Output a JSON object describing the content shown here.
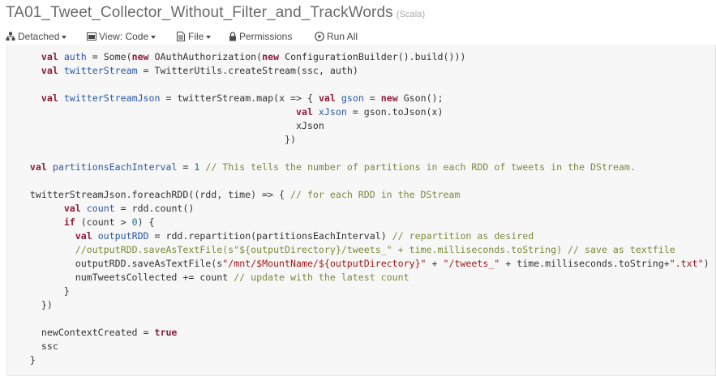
{
  "notebook": {
    "title": "TA01_Tweet_Collector_Without_Filter_and_TrackWords",
    "language": "(Scala)"
  },
  "toolbar": {
    "detached_label": "Detached",
    "view_label": "View: Code",
    "file_label": "File",
    "permissions_label": "Permissions",
    "run_all_label": "Run All"
  },
  "icons": [
    "cluster-icon",
    "view-icon",
    "file-icon",
    "lock-icon",
    "run-icon"
  ],
  "colors": {
    "keyword": "#8b1d38",
    "variable": "#2b57a6",
    "string": "#a11a1a",
    "comment": "#7a8b3a",
    "number": "#1a6fa0"
  },
  "code_lines": [
    [
      {
        "t": "      "
      },
      {
        "t": "val",
        "c": "kw"
      },
      {
        "t": " "
      },
      {
        "t": "auth",
        "c": "vr"
      },
      {
        "t": " = Some("
      },
      {
        "t": "new",
        "c": "kw"
      },
      {
        "t": " OAuthAuthorization("
      },
      {
        "t": "new",
        "c": "kw"
      },
      {
        "t": " ConfigurationBuilder().build()))"
      }
    ],
    [
      {
        "t": "      "
      },
      {
        "t": "val",
        "c": "kw"
      },
      {
        "t": " "
      },
      {
        "t": "twitterStream",
        "c": "vr"
      },
      {
        "t": " = TwitterUtils.createStream(ssc, auth)"
      }
    ],
    [
      {
        "t": ""
      }
    ],
    [
      {
        "t": "      "
      },
      {
        "t": "val",
        "c": "kw"
      },
      {
        "t": " "
      },
      {
        "t": "twitterStreamJson",
        "c": "vr"
      },
      {
        "t": " = twitterStream.map(x => { "
      },
      {
        "t": "val",
        "c": "kw"
      },
      {
        "t": " "
      },
      {
        "t": "gson",
        "c": "vr"
      },
      {
        "t": " = "
      },
      {
        "t": "new",
        "c": "kw"
      },
      {
        "t": " Gson();"
      }
    ],
    [
      {
        "t": "                                                   "
      },
      {
        "t": "val",
        "c": "kw"
      },
      {
        "t": " "
      },
      {
        "t": "xJson",
        "c": "vr"
      },
      {
        "t": " = gson.toJson(x)"
      }
    ],
    [
      {
        "t": "                                                   xJson"
      }
    ],
    [
      {
        "t": "                                                 })"
      }
    ],
    [
      {
        "t": ""
      }
    ],
    [
      {
        "t": "    "
      },
      {
        "t": "val",
        "c": "kw"
      },
      {
        "t": " "
      },
      {
        "t": "partitionsEachInterval",
        "c": "vr"
      },
      {
        "t": " = "
      },
      {
        "t": "1",
        "c": "nm"
      },
      {
        "t": " "
      },
      {
        "t": "// This tells the number of partitions in each RDD of tweets in the DStream.",
        "c": "cm"
      }
    ],
    [
      {
        "t": ""
      }
    ],
    [
      {
        "t": "    twitterStreamJson.foreachRDD((rdd, time) => { "
      },
      {
        "t": "// for each RDD in the DStream",
        "c": "cm"
      }
    ],
    [
      {
        "t": "          "
      },
      {
        "t": "val",
        "c": "kw"
      },
      {
        "t": " "
      },
      {
        "t": "count",
        "c": "vr"
      },
      {
        "t": " = rdd.count()"
      }
    ],
    [
      {
        "t": "          "
      },
      {
        "t": "if",
        "c": "kw"
      },
      {
        "t": " (count > "
      },
      {
        "t": "0",
        "c": "nm"
      },
      {
        "t": ") {"
      }
    ],
    [
      {
        "t": "            "
      },
      {
        "t": "val",
        "c": "kw"
      },
      {
        "t": " "
      },
      {
        "t": "outputRDD",
        "c": "vr"
      },
      {
        "t": " = rdd.repartition(partitionsEachInterval) "
      },
      {
        "t": "// repartition as desired",
        "c": "cm"
      }
    ],
    [
      {
        "t": "            "
      },
      {
        "t": "//outputRDD.saveAsTextFile(s\"${outputDirectory}/tweets_\" + time.milliseconds.toString) // save as textfile",
        "c": "cm"
      }
    ],
    [
      {
        "t": "            outputRDD.saveAsTextFile(s"
      },
      {
        "t": "\"/mnt/$MountName/${outputDirectory}\"",
        "c": "st"
      },
      {
        "t": " + "
      },
      {
        "t": "\"/tweets_\"",
        "c": "st"
      },
      {
        "t": " + time.milliseconds.toString+"
      },
      {
        "t": "\".txt\"",
        "c": "st"
      },
      {
        "t": ") /"
      }
    ],
    [
      {
        "t": "            numTweetsCollected += count "
      },
      {
        "t": "// update with the latest count",
        "c": "cm"
      }
    ],
    [
      {
        "t": "          }"
      }
    ],
    [
      {
        "t": "      })"
      }
    ],
    [
      {
        "t": ""
      }
    ],
    [
      {
        "t": "      newContextCreated = "
      },
      {
        "t": "true",
        "c": "kw"
      }
    ],
    [
      {
        "t": "      ssc"
      }
    ],
    [
      {
        "t": "    }"
      }
    ]
  ]
}
